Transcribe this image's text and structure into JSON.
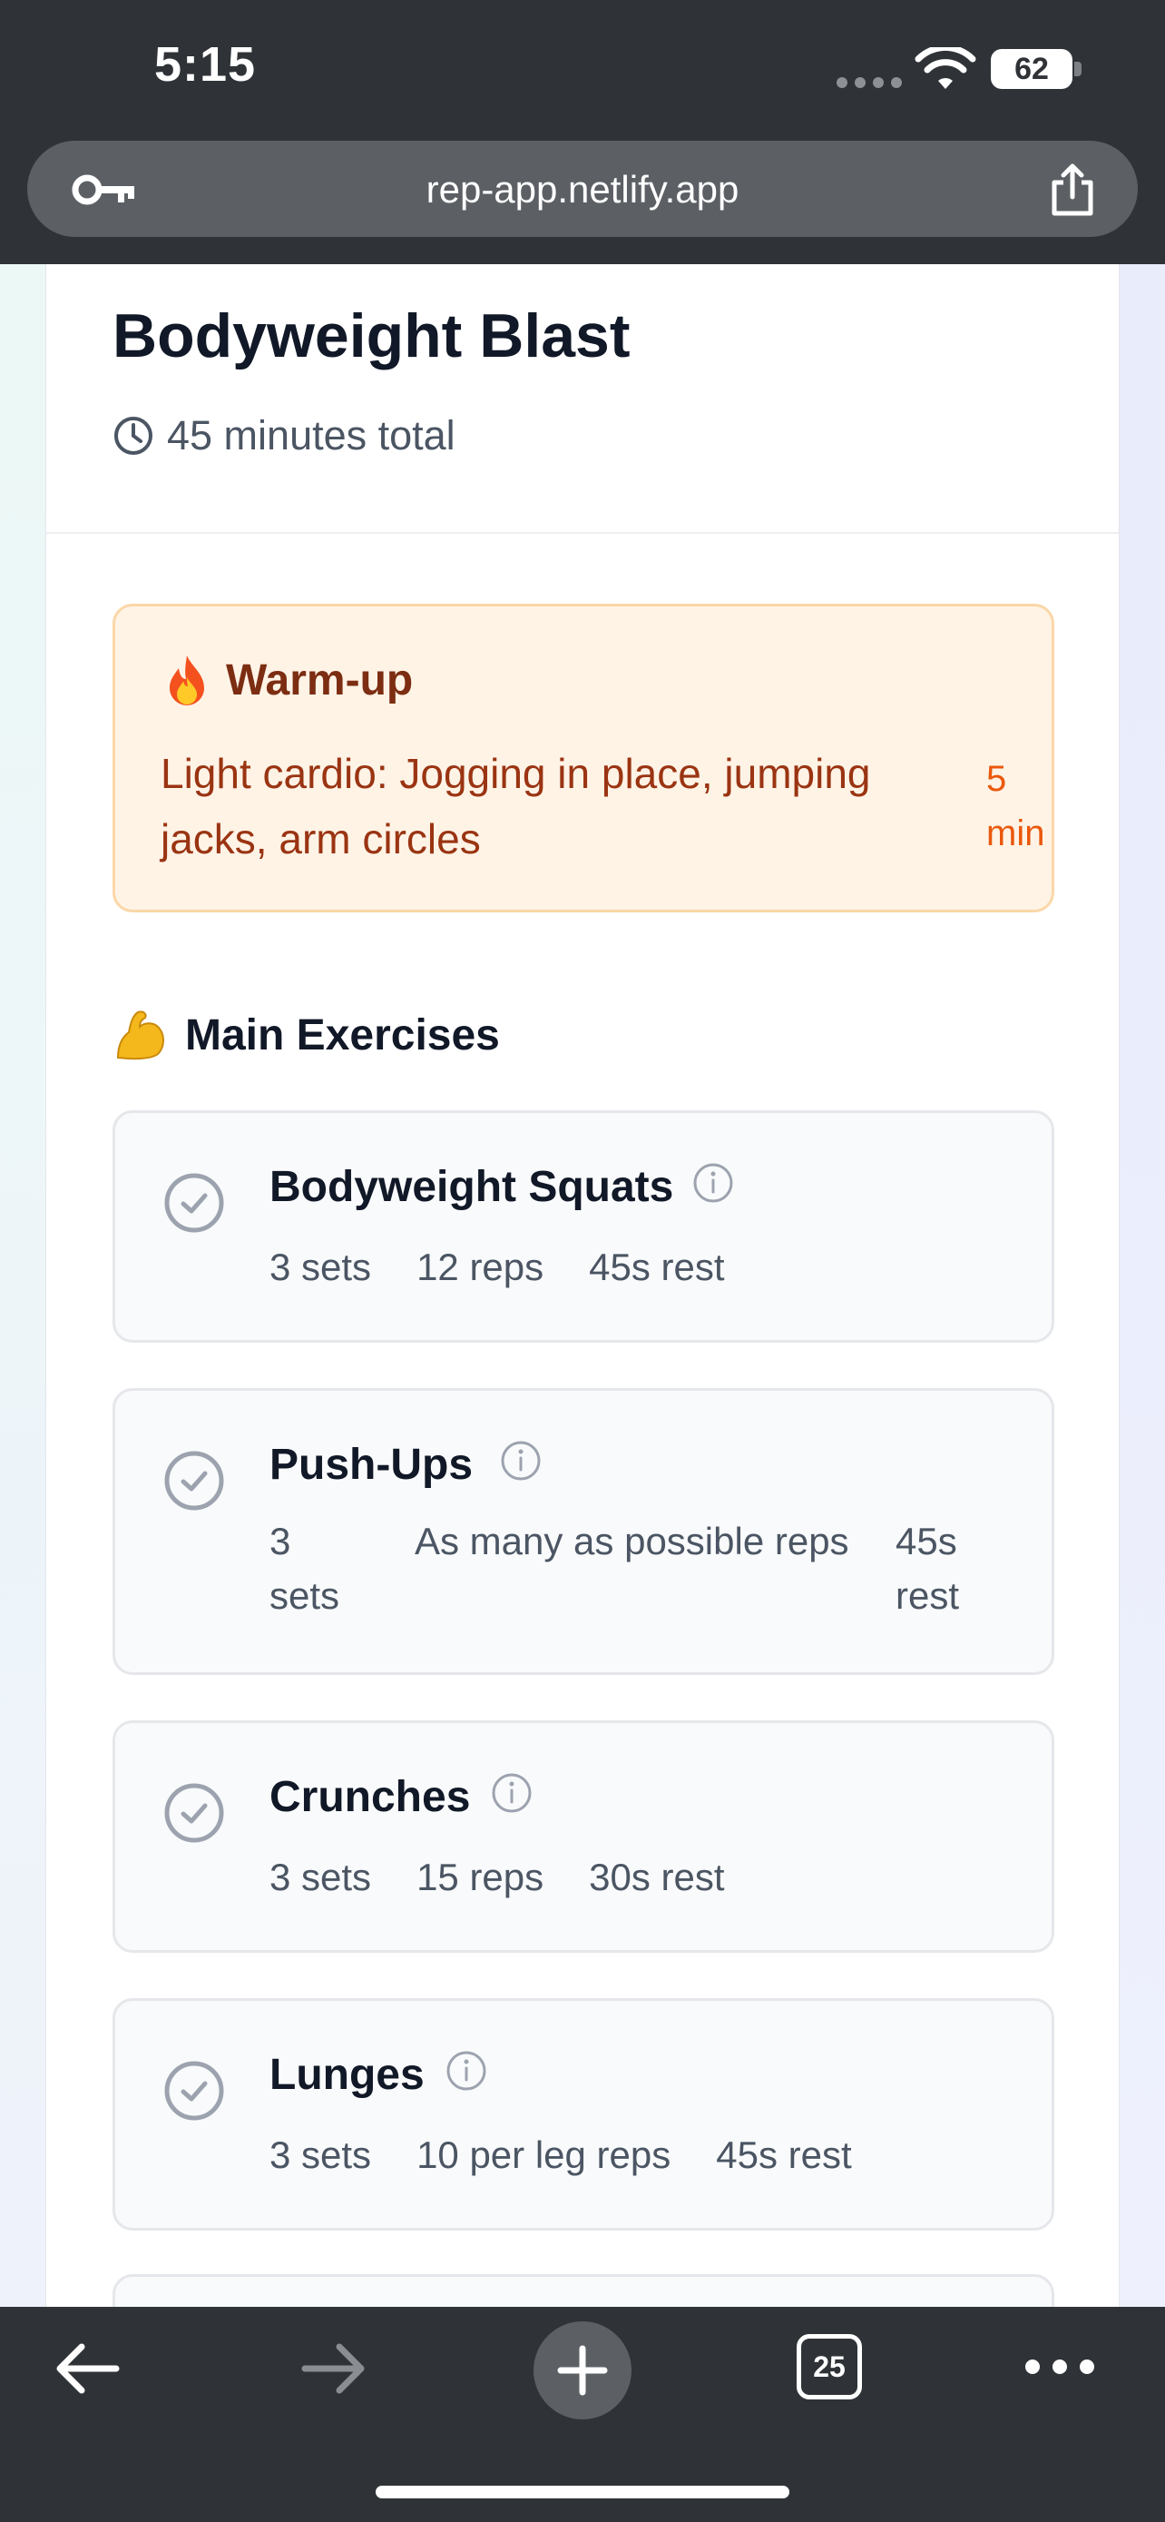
{
  "status_bar": {
    "time": "5:15",
    "battery": "62"
  },
  "browser": {
    "url": "rep-app.netlify.app",
    "tab_count": "25"
  },
  "workout": {
    "title": "Bodyweight Blast",
    "duration": "45 minutes total"
  },
  "warmup": {
    "title": "Warm-up",
    "description": "Light cardio: Jogging in place, jumping jacks, arm circles",
    "time": "5 min"
  },
  "main_section": {
    "title": "Main Exercises"
  },
  "exercises": [
    {
      "name": "Bodyweight Squats",
      "sets": "3 sets",
      "reps": "12 reps",
      "rest": "45s rest"
    },
    {
      "name": "Push-Ups",
      "sets": "3 sets",
      "reps": "As many as possible reps",
      "rest": "45s rest"
    },
    {
      "name": "Crunches",
      "sets": "3 sets",
      "reps": "15 reps",
      "rest": "30s rest"
    },
    {
      "name": "Lunges",
      "sets": "3 sets",
      "reps": "10 per leg reps",
      "rest": "45s rest"
    }
  ],
  "icons": {
    "key": "key-icon",
    "share": "share-icon",
    "clock": "clock-icon",
    "fire": "fire-icon",
    "muscle": "flexed-biceps-icon",
    "check": "check-circle-icon",
    "info": "info-icon",
    "back": "arrow-left-icon",
    "forward": "arrow-right-icon",
    "new_tab": "plus-icon",
    "more": "more-icon"
  }
}
